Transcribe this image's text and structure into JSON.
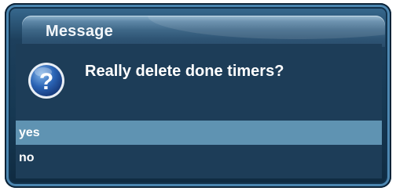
{
  "dialog": {
    "title": "Message",
    "prompt": "Really delete done timers?",
    "icon": "question-icon",
    "options": [
      {
        "label": "yes",
        "selected": true
      },
      {
        "label": "no",
        "selected": false
      }
    ]
  },
  "colors": {
    "frame": "#1d3f5c",
    "title_bar": "#4a7393",
    "content_bg": "#1d3d58",
    "selection": "#5f93b2",
    "text": "#ffffff"
  }
}
